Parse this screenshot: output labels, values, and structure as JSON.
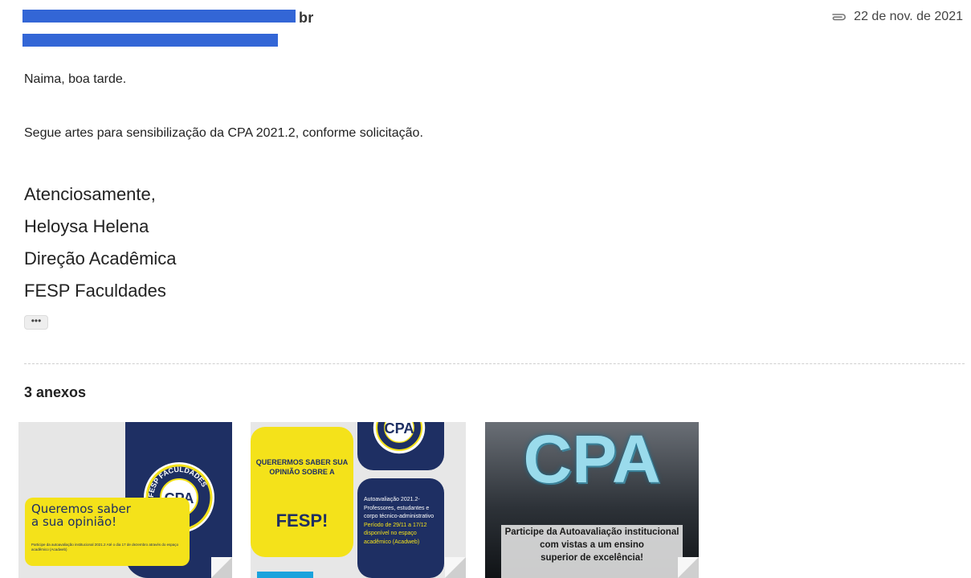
{
  "header": {
    "sender_suffix": "br",
    "date": "22 de nov. de 2021"
  },
  "message": {
    "greeting": "Naima, boa tarde.",
    "body": "Segue artes para sensibilização da CPA 2021.2, conforme solicitação.",
    "signature": [
      "Atenciosamente,",
      "Heloysa Helena",
      "Direção Acadêmica",
      "FESP Faculdades"
    ],
    "more_label": "•••"
  },
  "attachments": {
    "count_label": "3 anexos",
    "thumb1": {
      "title_line1": "Queremos saber",
      "title_line2": "a sua opinião!",
      "seal_top": "FESP FACULDADES",
      "seal_center": "CPA",
      "fine_print": "Participe da autoavaliação institucional 2021.2 Até o dia 17 de dezembro através do espaço acadêmico (Acadweb)"
    },
    "thumb2": {
      "seal_center": "CPA",
      "question": "QUERERMOS SABER SUA OPINIÃO SOBRE A",
      "fesp": "FESP!",
      "box_text_1": "Autoavaliação 2021.2- Professores, estudantes e corpo técnico-administrativo",
      "box_text_2": "Período de 29/11 a 17/12 disponível no espaço acadêmico (Acadweb)"
    },
    "thumb3": {
      "big_text": "CPA",
      "line1": "Participe da Autoavaliação institucional",
      "line2": "com vistas a um ensino",
      "line3": "superior de excelência!"
    }
  },
  "colors": {
    "redaction": "#3366d6",
    "navy": "#1e2f63",
    "yellow": "#f4e21a"
  }
}
